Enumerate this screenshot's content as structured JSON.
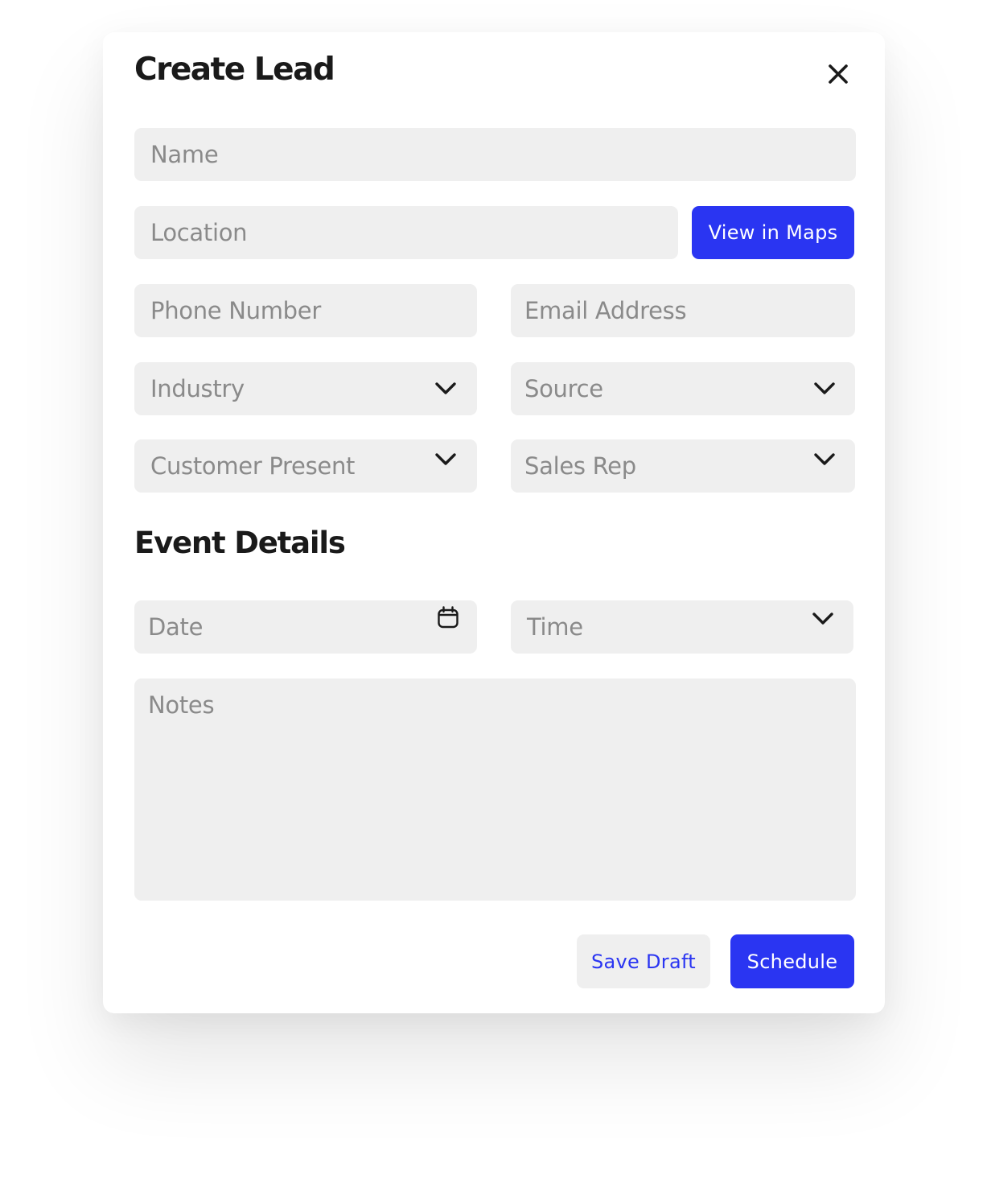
{
  "modal": {
    "title": "Create Lead",
    "close_icon": "close-icon"
  },
  "fields": {
    "name": {
      "placeholder": "Name"
    },
    "location": {
      "placeholder": "Location"
    },
    "phone": {
      "placeholder": "Phone Number"
    },
    "email": {
      "placeholder": "Email Address"
    },
    "industry": {
      "placeholder": "Industry",
      "icon": "chevron-down-icon"
    },
    "source": {
      "placeholder": "Source",
      "icon": "chevron-down-icon"
    },
    "customer_present": {
      "placeholder": "Customer Present",
      "icon": "chevron-down-icon"
    },
    "sales_rep": {
      "placeholder": "Sales Rep",
      "icon": "chevron-down-icon"
    }
  },
  "buttons": {
    "view_in_maps": "View in Maps",
    "save_draft": "Save Draft",
    "schedule": "Schedule"
  },
  "event_details": {
    "heading": "Event Details",
    "date": {
      "placeholder": "Date",
      "icon": "calendar-icon"
    },
    "time": {
      "placeholder": "Time",
      "icon": "chevron-down-icon"
    },
    "notes": {
      "placeholder": "Notes"
    }
  },
  "colors": {
    "accent": "#2a35f2",
    "field_bg": "#efefef",
    "placeholder": "#8a8a8a",
    "heading": "#1a1a1a"
  }
}
